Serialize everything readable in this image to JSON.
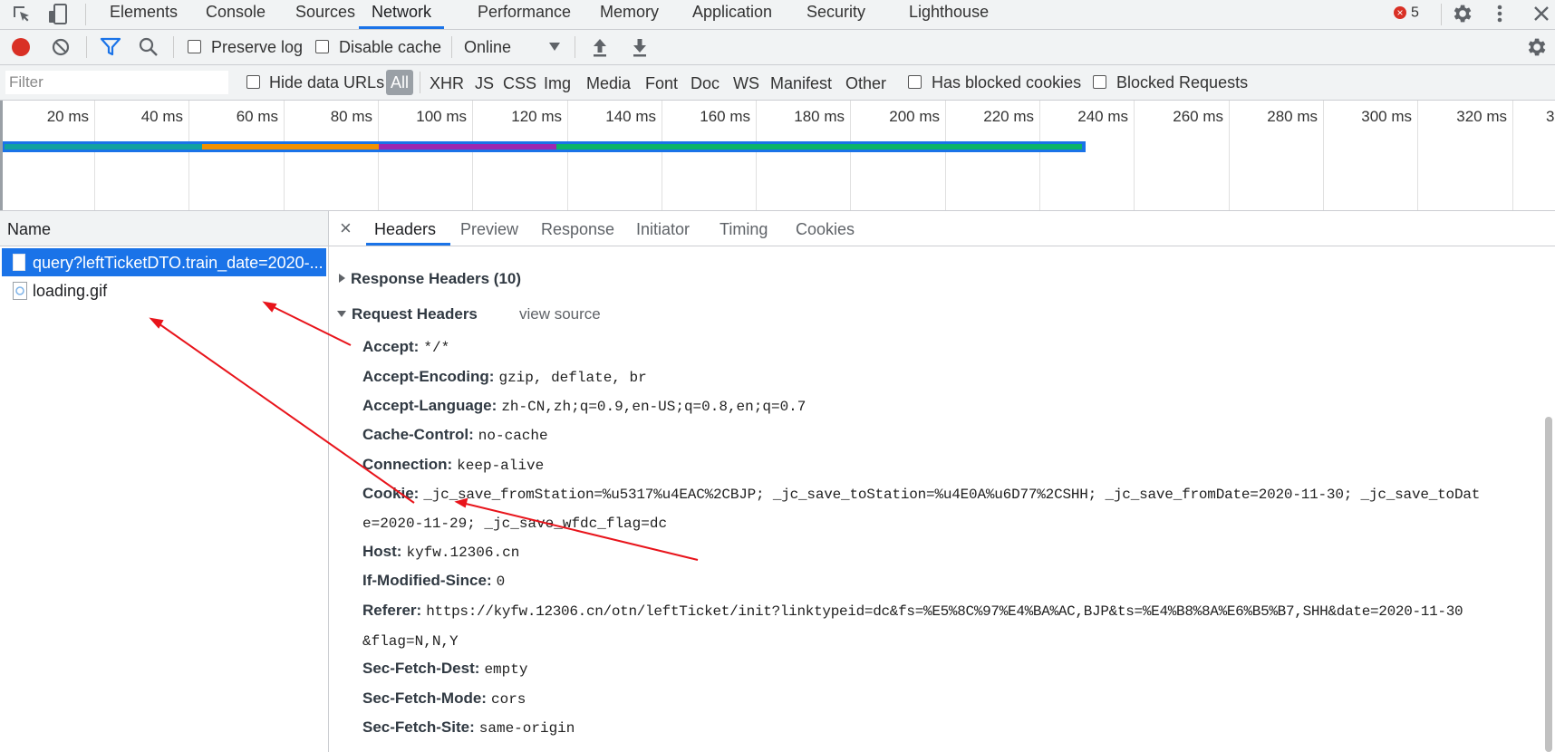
{
  "tabs": [
    "Elements",
    "Console",
    "Sources",
    "Network",
    "Performance",
    "Memory",
    "Application",
    "Security",
    "Lighthouse"
  ],
  "active_tab": "Network",
  "error_count": "5",
  "toolbar": {
    "preserve_log": "Preserve log",
    "disable_cache": "Disable cache",
    "throttle": "Online"
  },
  "filter": {
    "placeholder": "Filter",
    "hide_data_urls": "Hide data URLs",
    "types": [
      "All",
      "XHR",
      "JS",
      "CSS",
      "Img",
      "Media",
      "Font",
      "Doc",
      "WS",
      "Manifest",
      "Other"
    ],
    "has_blocked_cookies": "Has blocked cookies",
    "blocked_requests": "Blocked Requests"
  },
  "overview": {
    "ticks": [
      "20 ms",
      "40 ms",
      "60 ms",
      "80 ms",
      "100 ms",
      "120 ms",
      "140 ms",
      "160 ms",
      "180 ms",
      "200 ms",
      "220 ms",
      "240 ms",
      "260 ms",
      "280 ms",
      "300 ms",
      "320 ms",
      "3"
    ]
  },
  "requests": {
    "header": "Name",
    "items": [
      {
        "name": "query?leftTicketDTO.train_date=2020-..."
      },
      {
        "name": "loading.gif"
      }
    ]
  },
  "detail": {
    "close": "×",
    "tabs": [
      "Headers",
      "Preview",
      "Response",
      "Initiator",
      "Timing",
      "Cookies"
    ],
    "active": "Headers",
    "response_headers": "Response Headers (10)",
    "request_headers": "Request Headers",
    "view_source": "view source",
    "headers": [
      {
        "key": "Accept:",
        "value": "*/*"
      },
      {
        "key": "Accept-Encoding:",
        "value": "gzip, deflate, br"
      },
      {
        "key": "Accept-Language:",
        "value": "zh-CN,zh;q=0.9,en-US;q=0.8,en;q=0.7"
      },
      {
        "key": "Cache-Control:",
        "value": "no-cache"
      },
      {
        "key": "Connection:",
        "value": "keep-alive"
      },
      {
        "key": "Cookie:",
        "value": "_jc_save_fromStation=%u5317%u4EAC%2CBJP; _jc_save_toStation=%u4E0A%u6D77%2CSHH; _jc_save_fromDate=2020-11-30; _jc_save_toDat",
        "value2": "e=2020-11-29; _jc_save_wfdc_flag=dc"
      },
      {
        "key": "Host:",
        "value": "kyfw.12306.cn"
      },
      {
        "key": "If-Modified-Since:",
        "value": "0"
      },
      {
        "key": "Referer:",
        "value": "https://kyfw.12306.cn/otn/leftTicket/init?linktypeid=dc&fs=%E5%8C%97%E4%BA%AC,BJP&ts=%E4%B8%8A%E6%B5%B7,SHH&date=2020-11-30",
        "value2": "&flag=N,N,Y"
      },
      {
        "key": "Sec-Fetch-Dest:",
        "value": "empty"
      },
      {
        "key": "Sec-Fetch-Mode:",
        "value": "cors"
      },
      {
        "key": "Sec-Fetch-Site:",
        "value": "same-origin"
      }
    ]
  },
  "colors": {
    "accent": "#1a73e8",
    "record": "#d93025",
    "annotation": "#e8141b"
  }
}
